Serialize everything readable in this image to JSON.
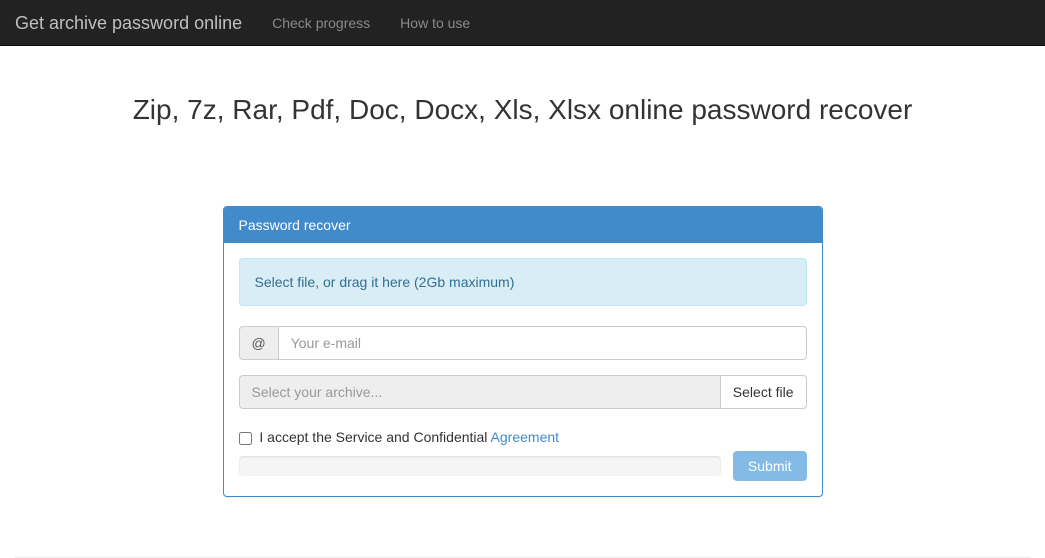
{
  "nav": {
    "brand": "Get archive password online",
    "links": [
      "Check progress",
      "How to use"
    ]
  },
  "headline": "Zip, 7z, Rar, Pdf, Doc, Docx, Xls, Xlsx online password recover",
  "panel": {
    "title": "Password recover",
    "dropzone": "Select file, or drag it here (2Gb maximum)",
    "email_addon": "@",
    "email_placeholder": "Your e-mail",
    "archive_placeholder": "Select your archive...",
    "select_file_btn": "Select file",
    "accept_text_prefix": "I accept the Service and Confidential ",
    "agreement_link": "Agreement",
    "submit": "Submit"
  }
}
